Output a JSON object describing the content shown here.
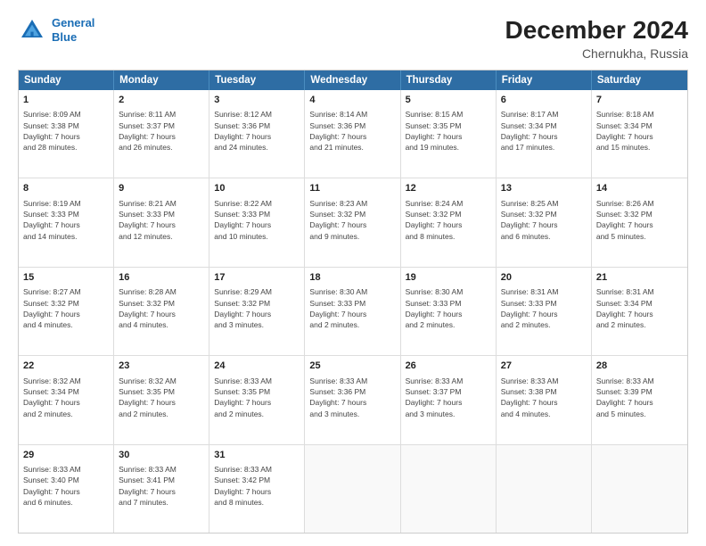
{
  "header": {
    "logo_line1": "General",
    "logo_line2": "Blue",
    "title": "December 2024",
    "subtitle": "Chernukha, Russia"
  },
  "days_of_week": [
    "Sunday",
    "Monday",
    "Tuesday",
    "Wednesday",
    "Thursday",
    "Friday",
    "Saturday"
  ],
  "weeks": [
    [
      {
        "day": "1",
        "info": "Sunrise: 8:09 AM\nSunset: 3:38 PM\nDaylight: 7 hours\nand 28 minutes."
      },
      {
        "day": "2",
        "info": "Sunrise: 8:11 AM\nSunset: 3:37 PM\nDaylight: 7 hours\nand 26 minutes."
      },
      {
        "day": "3",
        "info": "Sunrise: 8:12 AM\nSunset: 3:36 PM\nDaylight: 7 hours\nand 24 minutes."
      },
      {
        "day": "4",
        "info": "Sunrise: 8:14 AM\nSunset: 3:36 PM\nDaylight: 7 hours\nand 21 minutes."
      },
      {
        "day": "5",
        "info": "Sunrise: 8:15 AM\nSunset: 3:35 PM\nDaylight: 7 hours\nand 19 minutes."
      },
      {
        "day": "6",
        "info": "Sunrise: 8:17 AM\nSunset: 3:34 PM\nDaylight: 7 hours\nand 17 minutes."
      },
      {
        "day": "7",
        "info": "Sunrise: 8:18 AM\nSunset: 3:34 PM\nDaylight: 7 hours\nand 15 minutes."
      }
    ],
    [
      {
        "day": "8",
        "info": "Sunrise: 8:19 AM\nSunset: 3:33 PM\nDaylight: 7 hours\nand 14 minutes."
      },
      {
        "day": "9",
        "info": "Sunrise: 8:21 AM\nSunset: 3:33 PM\nDaylight: 7 hours\nand 12 minutes."
      },
      {
        "day": "10",
        "info": "Sunrise: 8:22 AM\nSunset: 3:33 PM\nDaylight: 7 hours\nand 10 minutes."
      },
      {
        "day": "11",
        "info": "Sunrise: 8:23 AM\nSunset: 3:32 PM\nDaylight: 7 hours\nand 9 minutes."
      },
      {
        "day": "12",
        "info": "Sunrise: 8:24 AM\nSunset: 3:32 PM\nDaylight: 7 hours\nand 8 minutes."
      },
      {
        "day": "13",
        "info": "Sunrise: 8:25 AM\nSunset: 3:32 PM\nDaylight: 7 hours\nand 6 minutes."
      },
      {
        "day": "14",
        "info": "Sunrise: 8:26 AM\nSunset: 3:32 PM\nDaylight: 7 hours\nand 5 minutes."
      }
    ],
    [
      {
        "day": "15",
        "info": "Sunrise: 8:27 AM\nSunset: 3:32 PM\nDaylight: 7 hours\nand 4 minutes."
      },
      {
        "day": "16",
        "info": "Sunrise: 8:28 AM\nSunset: 3:32 PM\nDaylight: 7 hours\nand 4 minutes."
      },
      {
        "day": "17",
        "info": "Sunrise: 8:29 AM\nSunset: 3:32 PM\nDaylight: 7 hours\nand 3 minutes."
      },
      {
        "day": "18",
        "info": "Sunrise: 8:30 AM\nSunset: 3:33 PM\nDaylight: 7 hours\nand 2 minutes."
      },
      {
        "day": "19",
        "info": "Sunrise: 8:30 AM\nSunset: 3:33 PM\nDaylight: 7 hours\nand 2 minutes."
      },
      {
        "day": "20",
        "info": "Sunrise: 8:31 AM\nSunset: 3:33 PM\nDaylight: 7 hours\nand 2 minutes."
      },
      {
        "day": "21",
        "info": "Sunrise: 8:31 AM\nSunset: 3:34 PM\nDaylight: 7 hours\nand 2 minutes."
      }
    ],
    [
      {
        "day": "22",
        "info": "Sunrise: 8:32 AM\nSunset: 3:34 PM\nDaylight: 7 hours\nand 2 minutes."
      },
      {
        "day": "23",
        "info": "Sunrise: 8:32 AM\nSunset: 3:35 PM\nDaylight: 7 hours\nand 2 minutes."
      },
      {
        "day": "24",
        "info": "Sunrise: 8:33 AM\nSunset: 3:35 PM\nDaylight: 7 hours\nand 2 minutes."
      },
      {
        "day": "25",
        "info": "Sunrise: 8:33 AM\nSunset: 3:36 PM\nDaylight: 7 hours\nand 3 minutes."
      },
      {
        "day": "26",
        "info": "Sunrise: 8:33 AM\nSunset: 3:37 PM\nDaylight: 7 hours\nand 3 minutes."
      },
      {
        "day": "27",
        "info": "Sunrise: 8:33 AM\nSunset: 3:38 PM\nDaylight: 7 hours\nand 4 minutes."
      },
      {
        "day": "28",
        "info": "Sunrise: 8:33 AM\nSunset: 3:39 PM\nDaylight: 7 hours\nand 5 minutes."
      }
    ],
    [
      {
        "day": "29",
        "info": "Sunrise: 8:33 AM\nSunset: 3:40 PM\nDaylight: 7 hours\nand 6 minutes."
      },
      {
        "day": "30",
        "info": "Sunrise: 8:33 AM\nSunset: 3:41 PM\nDaylight: 7 hours\nand 7 minutes."
      },
      {
        "day": "31",
        "info": "Sunrise: 8:33 AM\nSunset: 3:42 PM\nDaylight: 7 hours\nand 8 minutes."
      },
      {
        "day": "",
        "info": ""
      },
      {
        "day": "",
        "info": ""
      },
      {
        "day": "",
        "info": ""
      },
      {
        "day": "",
        "info": ""
      }
    ]
  ]
}
